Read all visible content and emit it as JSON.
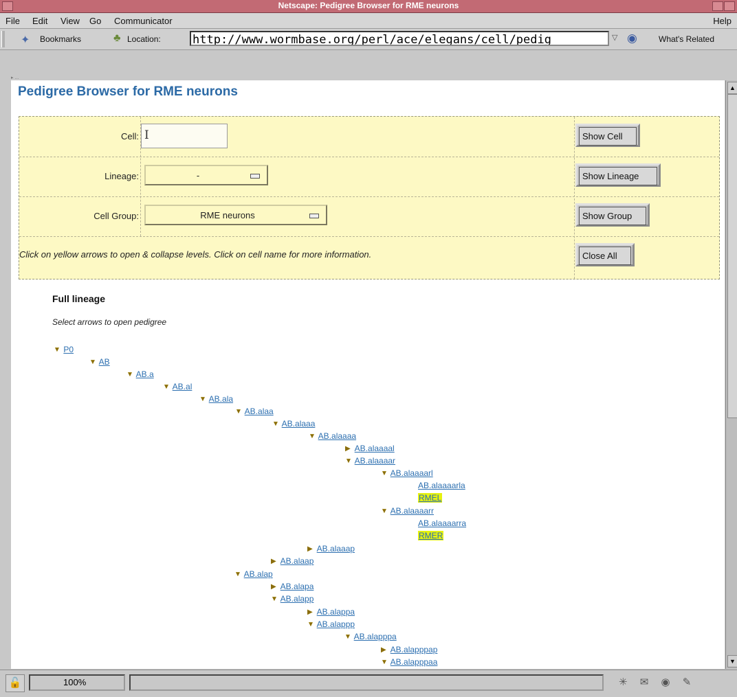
{
  "window": {
    "title": "Netscape: Pedigree Browser for RME neurons"
  },
  "menu": {
    "items": [
      "File",
      "Edit",
      "View",
      "Go",
      "Communicator"
    ],
    "help": "Help"
  },
  "toolbar": {
    "bookmarks_label": "Bookmarks",
    "location_label": "Location:",
    "url": "http://www.wormbase.org/perl/ace/elegans/cell/pedig",
    "whats_related_label": "What's Related"
  },
  "page": {
    "title": "Pedigree Browser for RME neurons",
    "form": {
      "cell_label": "Cell:",
      "cell_value": "",
      "lineage_label": "Lineage:",
      "lineage_value": "-",
      "group_label": "Cell Group:",
      "group_value": "RME neurons",
      "hint": "Click on yellow arrows to open & collapse levels. Click on cell name for more information.",
      "show_cell": "Show Cell",
      "show_lineage": "Show Lineage",
      "show_group": "Show Group",
      "close_all": "Close All"
    },
    "lineage_heading": "Full lineage",
    "lineage_subheading": "Select arrows to open pedigree",
    "tree": [
      {
        "label": "P0",
        "arrow": "down"
      },
      {
        "label": "AB",
        "arrow": "down"
      },
      {
        "label": "AB.a",
        "arrow": "down"
      },
      {
        "label": "AB.al",
        "arrow": "down"
      },
      {
        "label": "AB.ala",
        "arrow": "down"
      },
      {
        "label": "AB.alaa",
        "arrow": "down"
      },
      {
        "label": "AB.alaaa",
        "arrow": "down"
      },
      {
        "label": "AB.alaaaa",
        "arrow": "down"
      },
      {
        "label": "AB.alaaaal",
        "arrow": "right"
      },
      {
        "label": "AB.alaaaar",
        "arrow": "down"
      },
      {
        "label": "AB.alaaaarl",
        "arrow": "down"
      },
      {
        "label": "AB.alaaaarla",
        "arrow": "none"
      },
      {
        "label": "RMEL",
        "arrow": "none",
        "highlight": true
      },
      {
        "label": "AB.alaaaarr",
        "arrow": "down"
      },
      {
        "label": "AB.alaaaarra",
        "arrow": "none"
      },
      {
        "label": "RMER",
        "arrow": "none",
        "highlight": true
      },
      {
        "label": "AB.alaaap",
        "arrow": "right"
      },
      {
        "label": "AB.alaap",
        "arrow": "right"
      },
      {
        "label": "AB.alap",
        "arrow": "down"
      },
      {
        "label": "AB.alapa",
        "arrow": "right"
      },
      {
        "label": "AB.alapp",
        "arrow": "down"
      },
      {
        "label": "AB.alappa",
        "arrow": "right"
      },
      {
        "label": "AB.alappp",
        "arrow": "down"
      },
      {
        "label": "AB.alapppa",
        "arrow": "down"
      },
      {
        "label": "AB.alapppap",
        "arrow": "right"
      },
      {
        "label": "AB.alapppaa",
        "arrow": "down"
      }
    ]
  },
  "status": {
    "zoom": "100%"
  },
  "icons": [
    "bookmarks-icon",
    "location-icon",
    "whats-related-icon",
    "lock-icon",
    "component-bar-icons"
  ]
}
